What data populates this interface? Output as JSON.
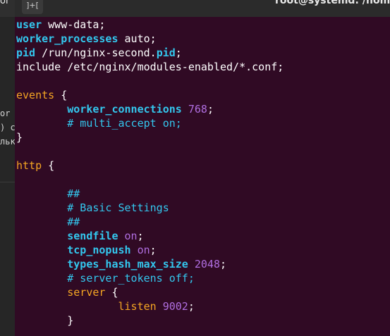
{
  "titlebar": {
    "new_tab_label": "]+[",
    "title": "root@systemd: /home/"
  },
  "background_window": {
    "title": "or",
    "lines": [
      "or",
      ") c",
      "льк"
    ]
  },
  "editor": {
    "lines": [
      [
        {
          "t": "user",
          "c": "kw"
        },
        {
          "t": " www-data;",
          "c": "plain"
        }
      ],
      [
        {
          "t": "worker_processes",
          "c": "kw"
        },
        {
          "t": " auto;",
          "c": "plain"
        }
      ],
      [
        {
          "t": "pid",
          "c": "kw"
        },
        {
          "t": " /run/nginx-second.",
          "c": "plain"
        },
        {
          "t": "pid",
          "c": "kw"
        },
        {
          "t": ";",
          "c": "plain"
        }
      ],
      [
        {
          "t": "include /etc/nginx/modules-enabled/*.conf;",
          "c": "plain"
        }
      ],
      [],
      [
        {
          "t": "events",
          "c": "blk"
        },
        {
          "t": " {",
          "c": "plain"
        }
      ],
      [
        {
          "t": "        ",
          "c": "plain"
        },
        {
          "t": "worker_connections",
          "c": "kw"
        },
        {
          "t": " ",
          "c": "plain"
        },
        {
          "t": "768",
          "c": "val"
        },
        {
          "t": ";",
          "c": "plain"
        }
      ],
      [
        {
          "t": "        # multi_accept on;",
          "c": "cmt"
        }
      ],
      [
        {
          "t": "}",
          "c": "plain"
        }
      ],
      [],
      [
        {
          "t": "http",
          "c": "blk"
        },
        {
          "t": " {",
          "c": "plain"
        }
      ],
      [],
      [
        {
          "t": "        ##",
          "c": "cmt"
        }
      ],
      [
        {
          "t": "        # Basic Settings",
          "c": "cmt"
        }
      ],
      [
        {
          "t": "        ##",
          "c": "cmt"
        }
      ],
      [
        {
          "t": "        ",
          "c": "plain"
        },
        {
          "t": "sendfile",
          "c": "kw"
        },
        {
          "t": " ",
          "c": "plain"
        },
        {
          "t": "on",
          "c": "val"
        },
        {
          "t": ";",
          "c": "plain"
        }
      ],
      [
        {
          "t": "        ",
          "c": "plain"
        },
        {
          "t": "tcp_nopush",
          "c": "kw"
        },
        {
          "t": " ",
          "c": "plain"
        },
        {
          "t": "on",
          "c": "val"
        },
        {
          "t": ";",
          "c": "plain"
        }
      ],
      [
        {
          "t": "        ",
          "c": "plain"
        },
        {
          "t": "types_hash_max_size",
          "c": "kw"
        },
        {
          "t": " ",
          "c": "plain"
        },
        {
          "t": "2048",
          "c": "val"
        },
        {
          "t": ";",
          "c": "plain"
        }
      ],
      [
        {
          "t": "        # server_tokens off;",
          "c": "cmt"
        }
      ],
      [
        {
          "t": "        ",
          "c": "plain"
        },
        {
          "t": "server",
          "c": "nested"
        },
        {
          "t": " {",
          "c": "plain"
        }
      ],
      [
        {
          "t": "                ",
          "c": "plain"
        },
        {
          "t": "listen",
          "c": "nested"
        },
        {
          "t": " ",
          "c": "plain"
        },
        {
          "t": "9002",
          "c": "val"
        },
        {
          "t": ";",
          "c": "plain"
        }
      ],
      [
        {
          "t": "        }",
          "c": "plain"
        }
      ]
    ]
  },
  "colors": {
    "background": "#300a24",
    "keyword": "#33c7ee",
    "block": "#f5a623",
    "value": "#b06ee0"
  }
}
